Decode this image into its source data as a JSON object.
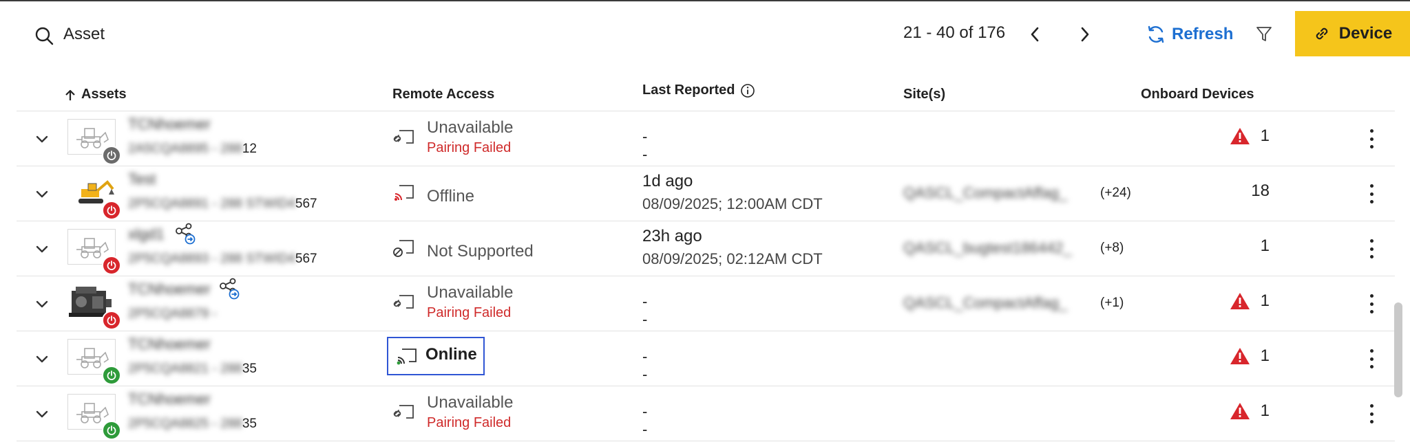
{
  "toolbar": {
    "search_value": "Asset",
    "pager": "21 - 40 of 176",
    "refresh_label": "Refresh",
    "device_label": "Device",
    "accent": "#1d6fd1",
    "device_color": "#f5c51b"
  },
  "table": {
    "headers": {
      "assets": "Assets",
      "remote_access": "Remote Access",
      "last_reported": "Last Reported",
      "sites": "Site(s)",
      "onboard": "Onboard Devices"
    },
    "rows": [
      {
        "name": "TCNhoemer",
        "serial_prefix": "2A5CQA8895 - 288",
        "serial_suffix": "12",
        "power": "gray",
        "remote_status": "Unavailable",
        "remote_sub": "Pairing Failed",
        "last_rel": "--",
        "last_abs": "",
        "site": "",
        "site_more": "",
        "onboard": "1",
        "warning": true
      },
      {
        "name": "Test",
        "serial_prefix": "2P5CQA8891 - 288 STWID4",
        "serial_suffix": "567",
        "power": "red",
        "remote_status": "Offline",
        "remote_sub": "",
        "last_rel": "1d ago",
        "last_abs": "08/09/2025; 12:00AM  CDT",
        "site": "QASCL_CompactAffag_",
        "site_more": "(+24)",
        "onboard": "18",
        "warning": false
      },
      {
        "name": "xlgd1",
        "serial_prefix": "2P5CQA8893 - 288 STWID4",
        "serial_suffix": "567",
        "power": "red",
        "remote_status": "Not Supported",
        "remote_sub": "",
        "last_rel": "23h ago",
        "last_abs": "08/09/2025; 02:12AM  CDT",
        "site": "QASCL_bugtest186442_",
        "site_more": "(+8)",
        "onboard": "1",
        "warning": false
      },
      {
        "name": "TCNhoemer",
        "serial_prefix": "2P5CQA8879 -",
        "serial_suffix": "",
        "power": "red",
        "remote_status": "Unavailable",
        "remote_sub": "Pairing Failed",
        "last_rel": "--",
        "last_abs": "",
        "site": "QASCL_CompactAffag_",
        "site_more": "(+1)",
        "onboard": "1",
        "warning": true
      },
      {
        "name": "TCNhoemer",
        "serial_prefix": "2P5CQA8821 - 288",
        "serial_suffix": "35",
        "power": "green",
        "remote_status": "Online",
        "remote_sub": "",
        "last_rel": "--",
        "last_abs": "",
        "site": "",
        "site_more": "",
        "onboard": "1",
        "warning": true
      },
      {
        "name": "TCNhoemer",
        "serial_prefix": "2P5CQA8825 - 288",
        "serial_suffix": "35",
        "power": "green",
        "remote_status": "Unavailable",
        "remote_sub": "Pairing Failed",
        "last_rel": "--",
        "last_abs": "",
        "site": "",
        "site_more": "",
        "onboard": "1",
        "warning": true
      }
    ]
  }
}
